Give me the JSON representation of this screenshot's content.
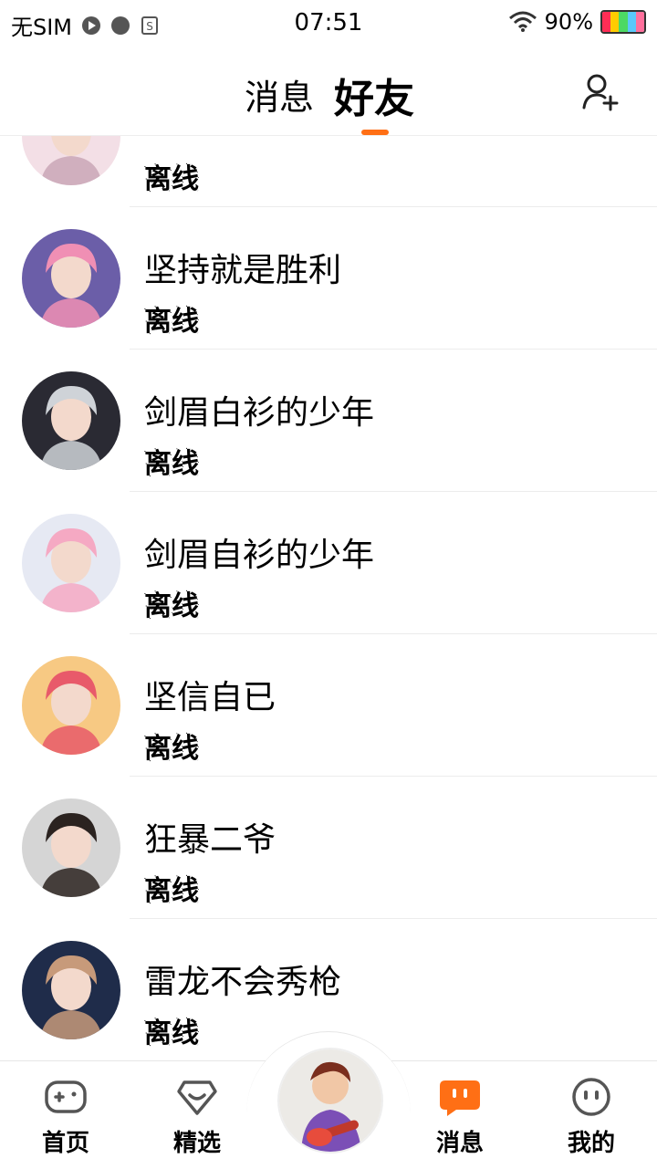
{
  "status_bar": {
    "carrier": "无SIM",
    "time": "07:51",
    "battery": "90%"
  },
  "header": {
    "tab_messages": "消息",
    "tab_friends": "好友",
    "accent": "#ff6f15"
  },
  "friends": [
    {
      "name": "",
      "status": "离线",
      "avatar_colors": [
        "#f3dfe6",
        "#c9a7b6"
      ]
    },
    {
      "name": "坚持就是胜利",
      "status": "离线",
      "avatar_colors": [
        "#6b5ea8",
        "#f08fb4"
      ]
    },
    {
      "name": "剑眉白衫的少年",
      "status": "离线",
      "avatar_colors": [
        "#2a2a33",
        "#cfd3d8"
      ]
    },
    {
      "name": "剑眉自衫的少年",
      "status": "离线",
      "avatar_colors": [
        "#e6e9f3",
        "#f5a9c3"
      ]
    },
    {
      "name": "坚信自已",
      "status": "离线",
      "avatar_colors": [
        "#f7c983",
        "#e85a6a"
      ]
    },
    {
      "name": "狂暴二爷",
      "status": "离线",
      "avatar_colors": [
        "#d5d5d5",
        "#2b2320"
      ]
    },
    {
      "name": "雷龙不会秀枪",
      "status": "离线",
      "avatar_colors": [
        "#1f2c4a",
        "#c79a7a"
      ]
    }
  ],
  "nav": {
    "home": "首页",
    "featured": "精选",
    "messages": "消息",
    "me": "我的",
    "active_color": "#ff6f15",
    "inactive_color": "#555555"
  }
}
